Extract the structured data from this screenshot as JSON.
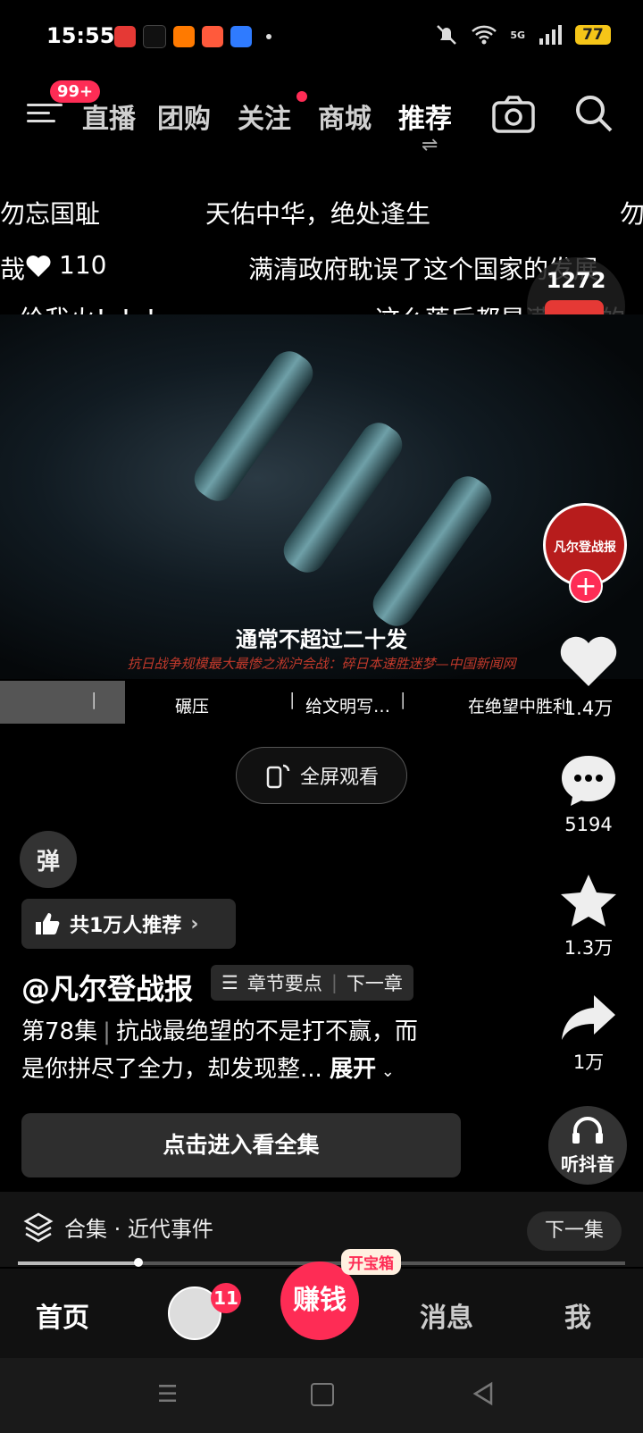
{
  "status_bar": {
    "time": "15:55",
    "app_icons": [
      "toutiao-icon",
      "tiktok-icon",
      "app-icon-orange",
      "app-icon-red",
      "baidu-icon"
    ],
    "battery": "77",
    "network": "5G"
  },
  "top_nav": {
    "badge": "99+",
    "tabs": [
      "直播",
      "团购",
      "关注",
      "商城",
      "推荐"
    ],
    "active_tab": "推荐"
  },
  "danmaku": {
    "row1": [
      "勿忘国耻",
      "天佑中华，绝处逢生",
      "勿"
    ],
    "row2_left": "哉",
    "row2_likes": "110",
    "row2_right": "满清政府耽误了这个国家的发展",
    "row3": [
      "给我火！！！",
      "这么落后都是满清造的"
    ]
  },
  "redpacket": {
    "count": "1272"
  },
  "video": {
    "subtitle": "通常不超过二十发",
    "source_line": "抗日战争规模最大最惨之淞沪会战：碎日本速胜迷梦—中国新闻网"
  },
  "chapters": [
    "碾压",
    "给文明写…",
    "在绝望中胜利"
  ],
  "fullscreen_label": "全屏观看",
  "right_rail": {
    "author_avatar_text": "凡尔登战报",
    "likes": "1.4万",
    "comments": "5194",
    "favorites": "1.3万",
    "shares": "1万",
    "listen_label": "听抖音"
  },
  "info": {
    "danmu_label": "弹",
    "recommend": "共1万人推荐",
    "author": "@凡尔登战报",
    "chapter_points": "章节要点",
    "next_chapter": "下一章",
    "episode": "第78集",
    "desc_line1": "抗战最绝望的不是打不赢，而",
    "desc_line2": "是你拼尽了全力，却发现整...",
    "expand": "展开",
    "watch_all": "点击进入看全集"
  },
  "collection": {
    "label": "合集 · 近代事件",
    "next": "下一集"
  },
  "bottom_nav": {
    "home": "首页",
    "friends_badge": "11",
    "earn": "赚钱",
    "treasure": "开宝箱",
    "messages": "消息",
    "me": "我"
  },
  "colors": {
    "accent": "#fe2c55"
  }
}
